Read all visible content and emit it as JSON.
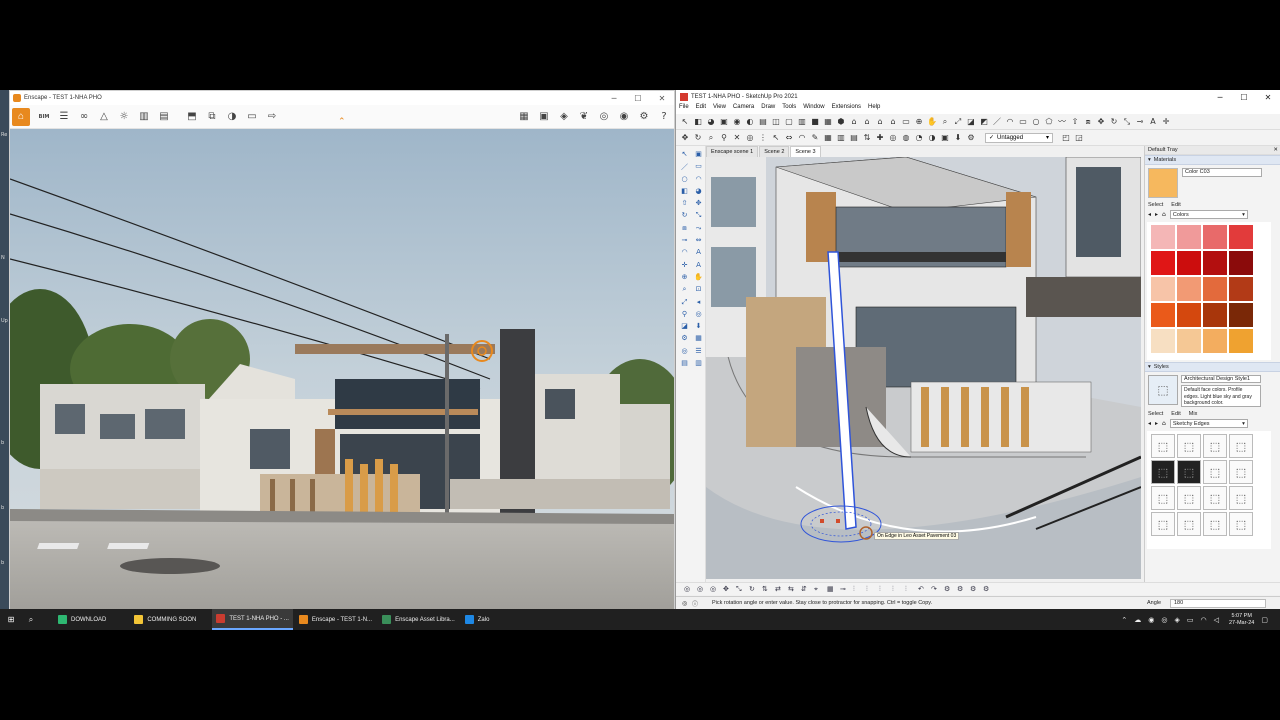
{
  "enscape": {
    "title": "Enscape - TEST 1-NHA PHO",
    "toolbar_icons": [
      "home-icon",
      "bim-icon",
      "list-icon",
      "binoculars-icon",
      "mountain-icon",
      "sun-icon",
      "buildings-icon",
      "clapperboard-icon",
      "screenshot-icon",
      "batch-render-icon",
      "panorama-icon",
      "export-icon"
    ],
    "bim_label": "BIM",
    "window_buttons": [
      "─",
      "☐",
      "✕"
    ]
  },
  "sketchup": {
    "title": "TEST 1-NHA PHO - SketchUp Pro 2021",
    "menu": [
      "File",
      "Edit",
      "View",
      "Camera",
      "Draw",
      "Tools",
      "Window",
      "Extensions",
      "Help"
    ],
    "tag": "Untagged",
    "scenes": [
      "Enscape scene 1",
      "Scene 2",
      "Scene 3"
    ],
    "tooltip": "On Edge in Leo Asset Pavement 03",
    "status_message": "Pick rotation angle or enter value.  Stay close to protractor for snapping. Ctrl = toggle Copy.",
    "angle_label": "Angle",
    "angle_value": "180",
    "window_buttons": [
      "─",
      "☐",
      "✕"
    ]
  },
  "tray": {
    "title": "Default Tray",
    "materials_header": "Materials",
    "material_name": "Color C03",
    "select_tab": "Select",
    "edit_tab": "Edit",
    "collection": "Colors",
    "swatch_colors": [
      "#f4b6b6",
      "#f09a9a",
      "#e86a6a",
      "#e23b3b",
      "#e01616",
      "#cc0d0d",
      "#b30f0f",
      "#8b0b0b",
      "#f7c4a8",
      "#f29a74",
      "#e36a3c",
      "#b23a17",
      "#ea5a1a",
      "#d4480e",
      "#a8360b",
      "#7a2807",
      "#f7dfc2",
      "#f5c895",
      "#f3ad5f",
      "#efa230"
    ],
    "styles_header": "Styles",
    "style_name": "Architectural Design Style1",
    "style_description": "Default face colors. Profile edges. Light blue sky and gray background color.",
    "mix_tab": "Mix",
    "style_collection": "Sketchy Edges"
  },
  "taskbar": {
    "items": [
      {
        "label": "DOWNLOAD",
        "color": "#2eb872"
      },
      {
        "label": "COMMING SOON",
        "color": "#f3c537"
      },
      {
        "label": "TEST 1-NHA PHO - ...",
        "color": "#c93c30"
      },
      {
        "label": "Enscape - TEST 1-N...",
        "color": "#e8891e"
      },
      {
        "label": "Enscape Asset Libra...",
        "color": "#3a8f5a"
      },
      {
        "label": "Zalo",
        "color": "#1e88e5"
      }
    ],
    "time": "5:07 PM",
    "date": "27-Mar-24"
  }
}
